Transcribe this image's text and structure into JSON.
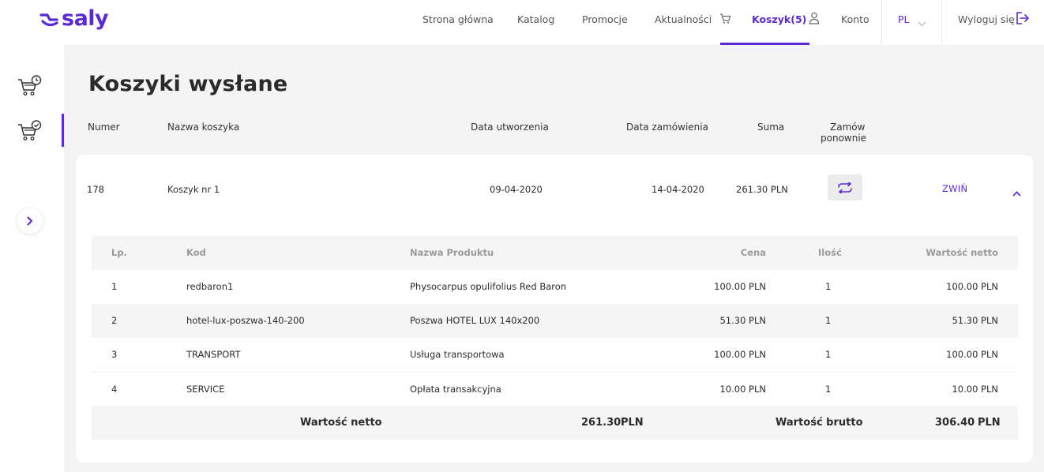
{
  "brand": {
    "name": "saly",
    "color": "#5b2ad6"
  },
  "nav": {
    "items": [
      "Strona główna",
      "Katalog",
      "Promocje",
      "Aktualności"
    ],
    "cart_label": "Koszyk(5)",
    "account_label": "Konto",
    "language": "PL",
    "logout_label": "Wyloguj się"
  },
  "page": {
    "title": "Koszyki wysłane"
  },
  "columns": {
    "number": "Numer",
    "name": "Nazwa koszyka",
    "created": "Data utworzenia",
    "ordered": "Data zamówienia",
    "sum": "Suma",
    "reorder_line1": "Zamów",
    "reorder_line2": "ponownie"
  },
  "basket": {
    "number": "178",
    "name": "Koszyk nr 1",
    "created": "09-04-2020",
    "ordered": "14-04-2020",
    "sum": "261.30 PLN",
    "collapse_label": "ZWIŃ",
    "reorder_icon": "refresh-icon"
  },
  "items_table": {
    "headers": {
      "lp": "Lp.",
      "code": "Kod",
      "product": "Nazwa Produktu",
      "price": "Cena",
      "qty": "Ilość",
      "net": "Wartość netto"
    },
    "rows": [
      {
        "lp": "1",
        "code": "redbaron1",
        "product": "Physocarpus opulifolius Red Baron",
        "price": "100.00 PLN",
        "qty": "1",
        "net": "100.00 PLN"
      },
      {
        "lp": "2",
        "code": "hotel-lux-poszwa-140-200",
        "product": "Poszwa HOTEL LUX 140x200",
        "price": "51.30 PLN",
        "qty": "1",
        "net": "51.30 PLN"
      },
      {
        "lp": "3",
        "code": "TRANSPORT",
        "product": "Usługa transportowa",
        "price": "100.00 PLN",
        "qty": "1",
        "net": "100.00 PLN"
      },
      {
        "lp": "4",
        "code": "SERVICE",
        "product": "Opłata transakcyjna",
        "price": "10.00 PLN",
        "qty": "1",
        "net": "10.00 PLN"
      }
    ],
    "summary": {
      "net_label": "Wartość netto",
      "net_value": "261.30",
      "net_currency": "PLN",
      "gross_label": "Wartość brutto",
      "gross_value": "306.40",
      "gross_currency": "PLN"
    }
  },
  "sidebar": {
    "icons": [
      "cart-clock-icon",
      "cart-check-icon",
      "chevron-right-icon"
    ]
  }
}
